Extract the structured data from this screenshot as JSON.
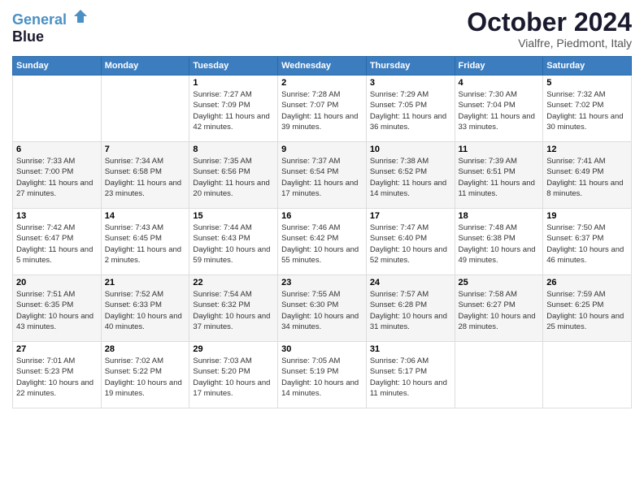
{
  "logo": {
    "line1": "General",
    "line2": "Blue"
  },
  "title": "October 2024",
  "subtitle": "Vialfre, Piedmont, Italy",
  "weekdays": [
    "Sunday",
    "Monday",
    "Tuesday",
    "Wednesday",
    "Thursday",
    "Friday",
    "Saturday"
  ],
  "weeks": [
    [
      {
        "day": "",
        "sunrise": "",
        "sunset": "",
        "daylight": ""
      },
      {
        "day": "",
        "sunrise": "",
        "sunset": "",
        "daylight": ""
      },
      {
        "day": "1",
        "sunrise": "Sunrise: 7:27 AM",
        "sunset": "Sunset: 7:09 PM",
        "daylight": "Daylight: 11 hours and 42 minutes."
      },
      {
        "day": "2",
        "sunrise": "Sunrise: 7:28 AM",
        "sunset": "Sunset: 7:07 PM",
        "daylight": "Daylight: 11 hours and 39 minutes."
      },
      {
        "day": "3",
        "sunrise": "Sunrise: 7:29 AM",
        "sunset": "Sunset: 7:05 PM",
        "daylight": "Daylight: 11 hours and 36 minutes."
      },
      {
        "day": "4",
        "sunrise": "Sunrise: 7:30 AM",
        "sunset": "Sunset: 7:04 PM",
        "daylight": "Daylight: 11 hours and 33 minutes."
      },
      {
        "day": "5",
        "sunrise": "Sunrise: 7:32 AM",
        "sunset": "Sunset: 7:02 PM",
        "daylight": "Daylight: 11 hours and 30 minutes."
      }
    ],
    [
      {
        "day": "6",
        "sunrise": "Sunrise: 7:33 AM",
        "sunset": "Sunset: 7:00 PM",
        "daylight": "Daylight: 11 hours and 27 minutes."
      },
      {
        "day": "7",
        "sunrise": "Sunrise: 7:34 AM",
        "sunset": "Sunset: 6:58 PM",
        "daylight": "Daylight: 11 hours and 23 minutes."
      },
      {
        "day": "8",
        "sunrise": "Sunrise: 7:35 AM",
        "sunset": "Sunset: 6:56 PM",
        "daylight": "Daylight: 11 hours and 20 minutes."
      },
      {
        "day": "9",
        "sunrise": "Sunrise: 7:37 AM",
        "sunset": "Sunset: 6:54 PM",
        "daylight": "Daylight: 11 hours and 17 minutes."
      },
      {
        "day": "10",
        "sunrise": "Sunrise: 7:38 AM",
        "sunset": "Sunset: 6:52 PM",
        "daylight": "Daylight: 11 hours and 14 minutes."
      },
      {
        "day": "11",
        "sunrise": "Sunrise: 7:39 AM",
        "sunset": "Sunset: 6:51 PM",
        "daylight": "Daylight: 11 hours and 11 minutes."
      },
      {
        "day": "12",
        "sunrise": "Sunrise: 7:41 AM",
        "sunset": "Sunset: 6:49 PM",
        "daylight": "Daylight: 11 hours and 8 minutes."
      }
    ],
    [
      {
        "day": "13",
        "sunrise": "Sunrise: 7:42 AM",
        "sunset": "Sunset: 6:47 PM",
        "daylight": "Daylight: 11 hours and 5 minutes."
      },
      {
        "day": "14",
        "sunrise": "Sunrise: 7:43 AM",
        "sunset": "Sunset: 6:45 PM",
        "daylight": "Daylight: 11 hours and 2 minutes."
      },
      {
        "day": "15",
        "sunrise": "Sunrise: 7:44 AM",
        "sunset": "Sunset: 6:43 PM",
        "daylight": "Daylight: 10 hours and 59 minutes."
      },
      {
        "day": "16",
        "sunrise": "Sunrise: 7:46 AM",
        "sunset": "Sunset: 6:42 PM",
        "daylight": "Daylight: 10 hours and 55 minutes."
      },
      {
        "day": "17",
        "sunrise": "Sunrise: 7:47 AM",
        "sunset": "Sunset: 6:40 PM",
        "daylight": "Daylight: 10 hours and 52 minutes."
      },
      {
        "day": "18",
        "sunrise": "Sunrise: 7:48 AM",
        "sunset": "Sunset: 6:38 PM",
        "daylight": "Daylight: 10 hours and 49 minutes."
      },
      {
        "day": "19",
        "sunrise": "Sunrise: 7:50 AM",
        "sunset": "Sunset: 6:37 PM",
        "daylight": "Daylight: 10 hours and 46 minutes."
      }
    ],
    [
      {
        "day": "20",
        "sunrise": "Sunrise: 7:51 AM",
        "sunset": "Sunset: 6:35 PM",
        "daylight": "Daylight: 10 hours and 43 minutes."
      },
      {
        "day": "21",
        "sunrise": "Sunrise: 7:52 AM",
        "sunset": "Sunset: 6:33 PM",
        "daylight": "Daylight: 10 hours and 40 minutes."
      },
      {
        "day": "22",
        "sunrise": "Sunrise: 7:54 AM",
        "sunset": "Sunset: 6:32 PM",
        "daylight": "Daylight: 10 hours and 37 minutes."
      },
      {
        "day": "23",
        "sunrise": "Sunrise: 7:55 AM",
        "sunset": "Sunset: 6:30 PM",
        "daylight": "Daylight: 10 hours and 34 minutes."
      },
      {
        "day": "24",
        "sunrise": "Sunrise: 7:57 AM",
        "sunset": "Sunset: 6:28 PM",
        "daylight": "Daylight: 10 hours and 31 minutes."
      },
      {
        "day": "25",
        "sunrise": "Sunrise: 7:58 AM",
        "sunset": "Sunset: 6:27 PM",
        "daylight": "Daylight: 10 hours and 28 minutes."
      },
      {
        "day": "26",
        "sunrise": "Sunrise: 7:59 AM",
        "sunset": "Sunset: 6:25 PM",
        "daylight": "Daylight: 10 hours and 25 minutes."
      }
    ],
    [
      {
        "day": "27",
        "sunrise": "Sunrise: 7:01 AM",
        "sunset": "Sunset: 5:23 PM",
        "daylight": "Daylight: 10 hours and 22 minutes."
      },
      {
        "day": "28",
        "sunrise": "Sunrise: 7:02 AM",
        "sunset": "Sunset: 5:22 PM",
        "daylight": "Daylight: 10 hours and 19 minutes."
      },
      {
        "day": "29",
        "sunrise": "Sunrise: 7:03 AM",
        "sunset": "Sunset: 5:20 PM",
        "daylight": "Daylight: 10 hours and 17 minutes."
      },
      {
        "day": "30",
        "sunrise": "Sunrise: 7:05 AM",
        "sunset": "Sunset: 5:19 PM",
        "daylight": "Daylight: 10 hours and 14 minutes."
      },
      {
        "day": "31",
        "sunrise": "Sunrise: 7:06 AM",
        "sunset": "Sunset: 5:17 PM",
        "daylight": "Daylight: 10 hours and 11 minutes."
      },
      {
        "day": "",
        "sunrise": "",
        "sunset": "",
        "daylight": ""
      },
      {
        "day": "",
        "sunrise": "",
        "sunset": "",
        "daylight": ""
      }
    ]
  ]
}
